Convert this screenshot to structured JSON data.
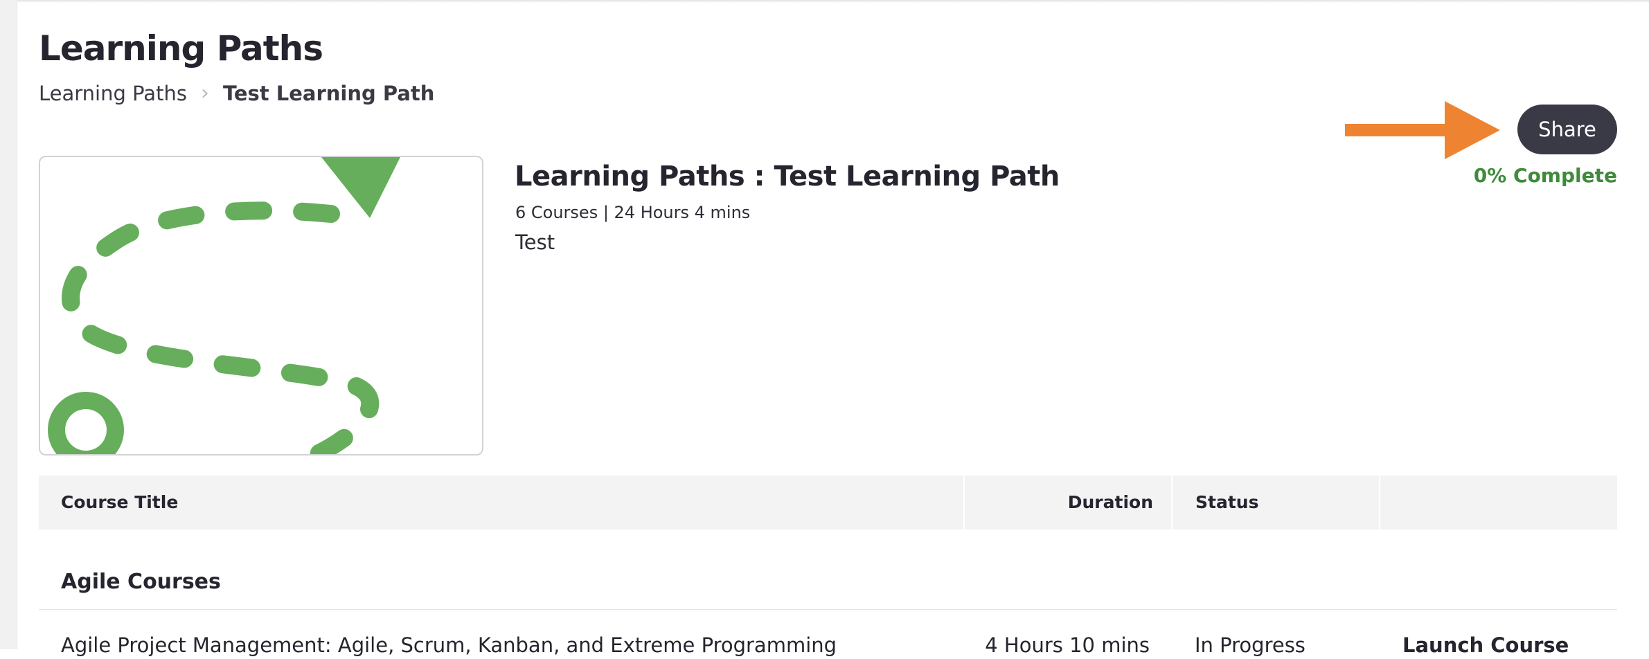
{
  "header": {
    "page_title": "Learning Paths"
  },
  "breadcrumb": {
    "items": [
      {
        "label": "Learning Paths"
      },
      {
        "label": "Test Learning Path"
      }
    ]
  },
  "actions": {
    "share_label": "Share",
    "completion_text": "0% Complete",
    "completion_percent": 0
  },
  "path": {
    "title": "Learning Paths : Test Learning Path",
    "meta": "6 Courses | 24 Hours 4 mins",
    "description": "Test",
    "thumbnail_icon": "dashed-path-icon"
  },
  "table": {
    "columns": [
      "Course Title",
      "Duration",
      "Status",
      ""
    ],
    "sections": [
      {
        "heading": "Agile Courses",
        "rows": [
          {
            "title": "Agile Project Management: Agile, Scrum, Kanban, and Extreme Programming",
            "duration": "4 Hours 10 mins",
            "status": "In Progress",
            "action": "Launch Course"
          }
        ]
      }
    ]
  },
  "colors": {
    "accent_green": "#3f8b3b",
    "illustration_green": "#66ae5c",
    "button_dark": "#3a3a47",
    "annotation_orange": "#ee8431"
  }
}
